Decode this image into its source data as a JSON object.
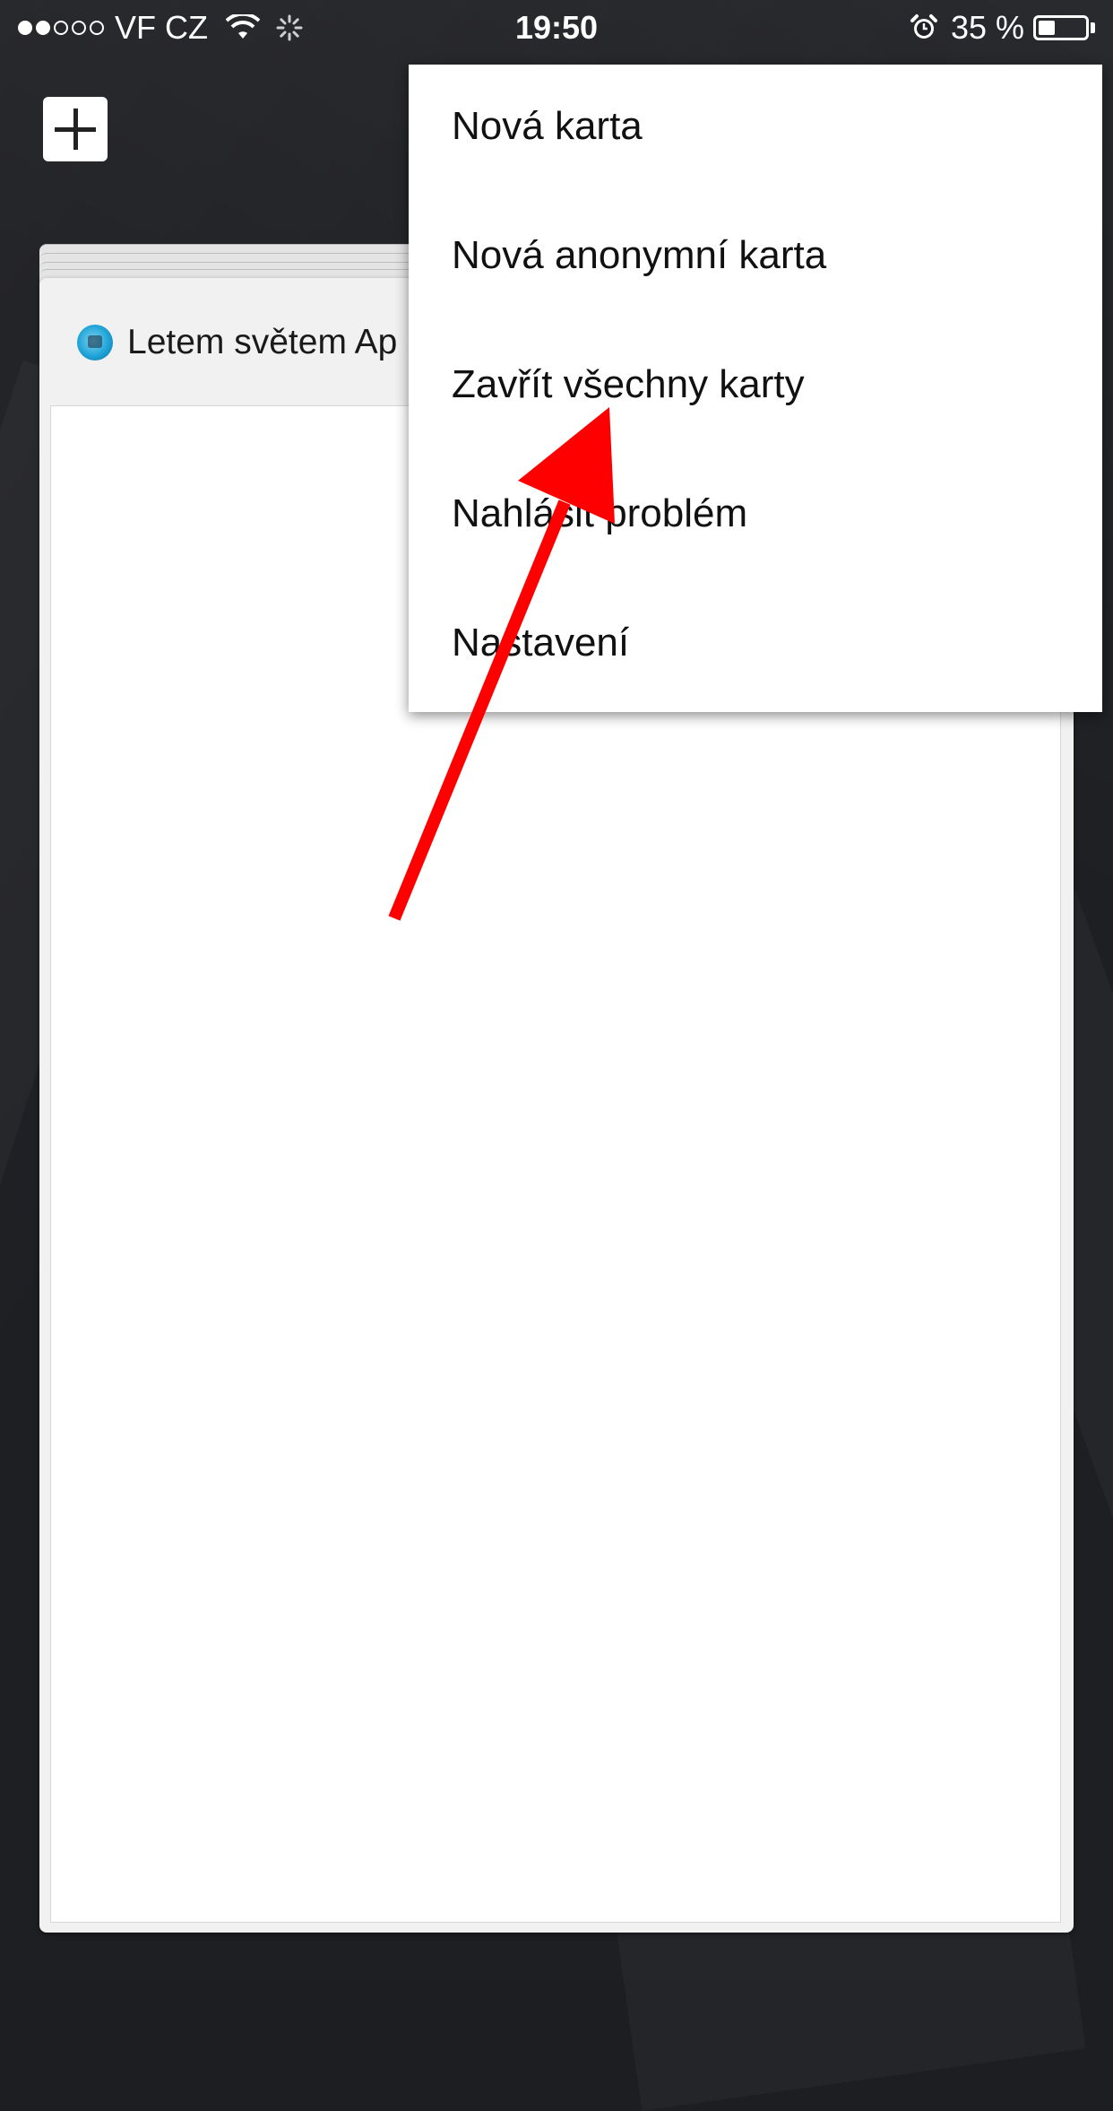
{
  "status_bar": {
    "signal_bars_filled": 2,
    "signal_bars_total": 5,
    "carrier": "VF CZ",
    "wifi_icon": "wifi-icon",
    "activity_icon": "loading-spinner-icon",
    "time": "19:50",
    "alarm_icon": "alarm-clock-icon",
    "battery_percent_text": "35 %",
    "battery_level": 0.35
  },
  "toolbar": {
    "add_tab_icon": "plus-icon"
  },
  "tab": {
    "title": "Letem světem Ap",
    "favicon_icon": "site-favicon"
  },
  "menu": {
    "items": [
      {
        "label": "Nová karta"
      },
      {
        "label": "Nová anonymní karta"
      },
      {
        "label": "Zavřít všechny karty"
      },
      {
        "label": "Nahlásit problém"
      },
      {
        "label": "Nastavení"
      }
    ]
  },
  "annotation": {
    "arrow_color": "#ff0000"
  },
  "colors": {
    "background": "#1e1f23",
    "menu_background": "#ffffff",
    "tab_card_background": "#f1f1f1"
  }
}
